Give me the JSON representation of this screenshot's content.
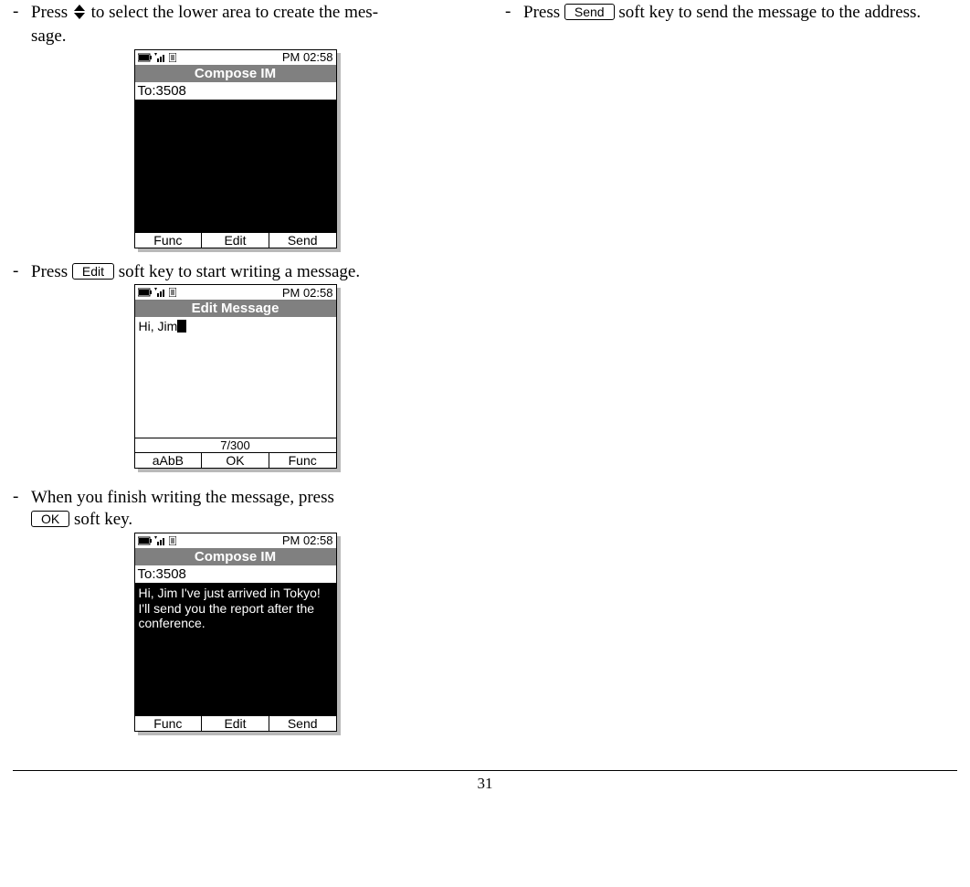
{
  "page_number": "31",
  "left": {
    "step1": {
      "prefix": "Press ",
      "suffix_a": " to select the lower area to create the mes",
      "hyph": "-",
      "line2": "sage."
    },
    "step2": {
      "prefix": "Press ",
      "key": "Edit",
      "suffix": " soft key to start writing a message."
    },
    "step3": {
      "line1": "When   you   finish   writing   the   message,   press",
      "key": "OK",
      "suffix": " soft key."
    }
  },
  "right": {
    "step1": {
      "prefix": "Press ",
      "key": "Send",
      "suffix": " soft key to send the message to the",
      "line2": "address."
    }
  },
  "phone": {
    "time": "PM 02:58",
    "p1": {
      "title": "Compose IM",
      "to": "To:3508",
      "body": "",
      "sk": [
        "Func",
        "Edit",
        "Send"
      ]
    },
    "p2": {
      "title": "Edit Message",
      "body": "Hi, Jim",
      "counter": "7/300",
      "sk": [
        "aAbB",
        "OK",
        "Func"
      ]
    },
    "p3": {
      "title": "Compose IM",
      "to": "To:3508",
      "body": "Hi, Jim I've just arrived in Tokyo! I'll send you the report after the conference.",
      "sk": [
        "Func",
        "Edit",
        "Send"
      ]
    }
  }
}
